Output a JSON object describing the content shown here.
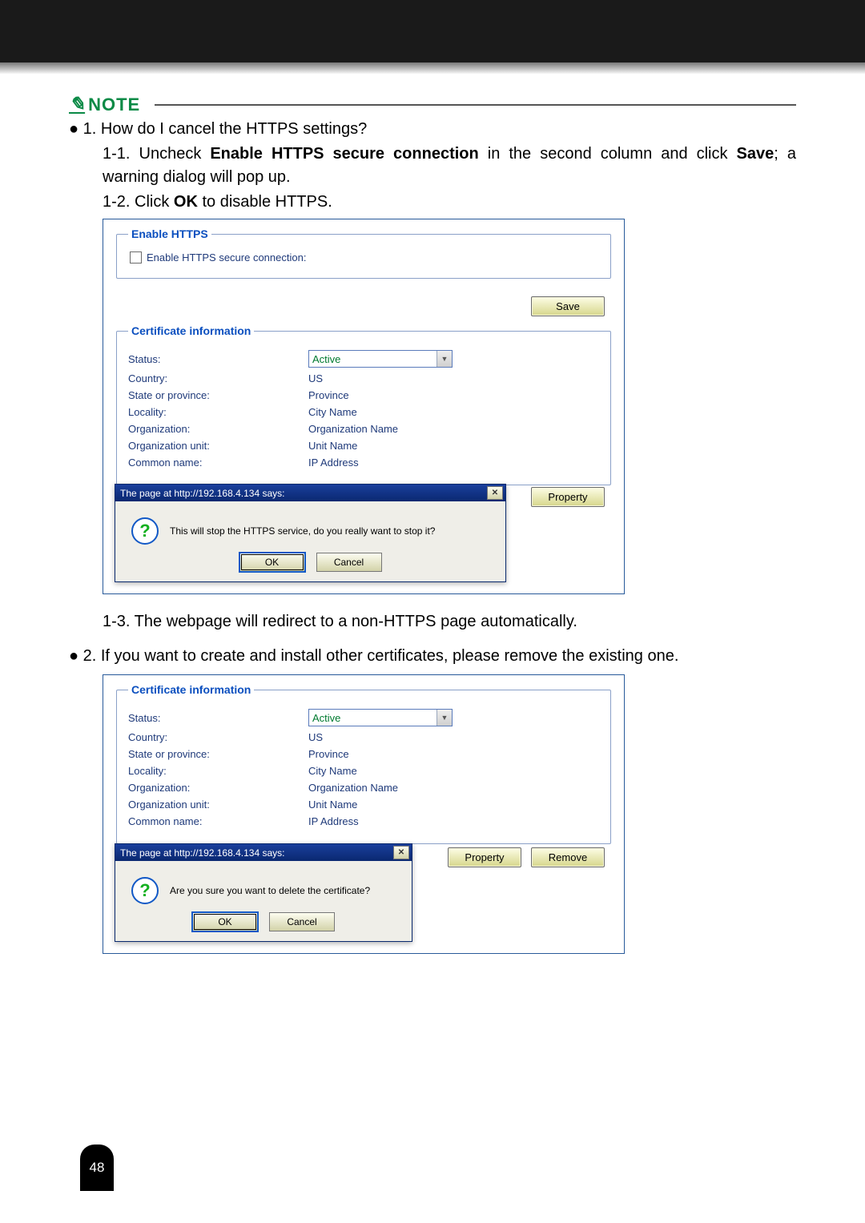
{
  "note": {
    "label": "NOTE"
  },
  "body": {
    "q1_prefix": "● 1. ",
    "q1_text": "How do I cancel the HTTPS settings?",
    "s1_1_num": "1-1. ",
    "s1_1_a": "Uncheck ",
    "s1_1_b": "Enable HTTPS secure connection",
    "s1_1_c": " in the second column and click ",
    "s1_1_d": "Save",
    "s1_1_e": "; a warning dialog will pop up.",
    "s1_2_num": "1-2. ",
    "s1_2_a": "Click ",
    "s1_2_b": "OK",
    "s1_2_c": " to disable HTTPS.",
    "s1_3_num": "1-3. ",
    "s1_3_a": "The webpage will redirect to a non-HTTPS page automatically.",
    "q2_prefix": "● 2. ",
    "q2_text": "If you want to create and install other certificates, please remove the existing one."
  },
  "fig1": {
    "enable_legend": "Enable HTTPS",
    "enable_label": "Enable HTTPS secure connection:",
    "save": "Save",
    "cert_legend": "Certificate information",
    "rows": {
      "status_l": "Status:",
      "status_v": "Active",
      "country_l": "Country:",
      "country_v": "US",
      "state_l": "State or province:",
      "state_v": "Province",
      "locality_l": "Locality:",
      "locality_v": "City Name",
      "org_l": "Organization:",
      "org_v": "Organization Name",
      "unit_l": "Organization unit:",
      "unit_v": "Unit Name",
      "cn_l": "Common name:",
      "cn_v": "IP Address"
    },
    "property": "Property",
    "dlg": {
      "title": "The page at http://192.168.4.134 says:",
      "msg": "This will stop the HTTPS service, do you really want to stop it?",
      "ok": "OK",
      "cancel": "Cancel"
    }
  },
  "fig2": {
    "cert_legend": "Certificate information",
    "rows": {
      "status_l": "Status:",
      "status_v": "Active",
      "country_l": "Country:",
      "country_v": "US",
      "state_l": "State or province:",
      "state_v": "Province",
      "locality_l": "Locality:",
      "locality_v": "City Name",
      "org_l": "Organization:",
      "org_v": "Organization Name",
      "unit_l": "Organization unit:",
      "unit_v": "Unit Name",
      "cn_l": "Common name:",
      "cn_v": "IP Address"
    },
    "property": "Property",
    "remove": "Remove",
    "dlg": {
      "title": "The page at http://192.168.4.134 says:",
      "msg": "Are you sure you want to delete the certificate?",
      "ok": "OK",
      "cancel": "Cancel"
    }
  },
  "page_number": "48"
}
